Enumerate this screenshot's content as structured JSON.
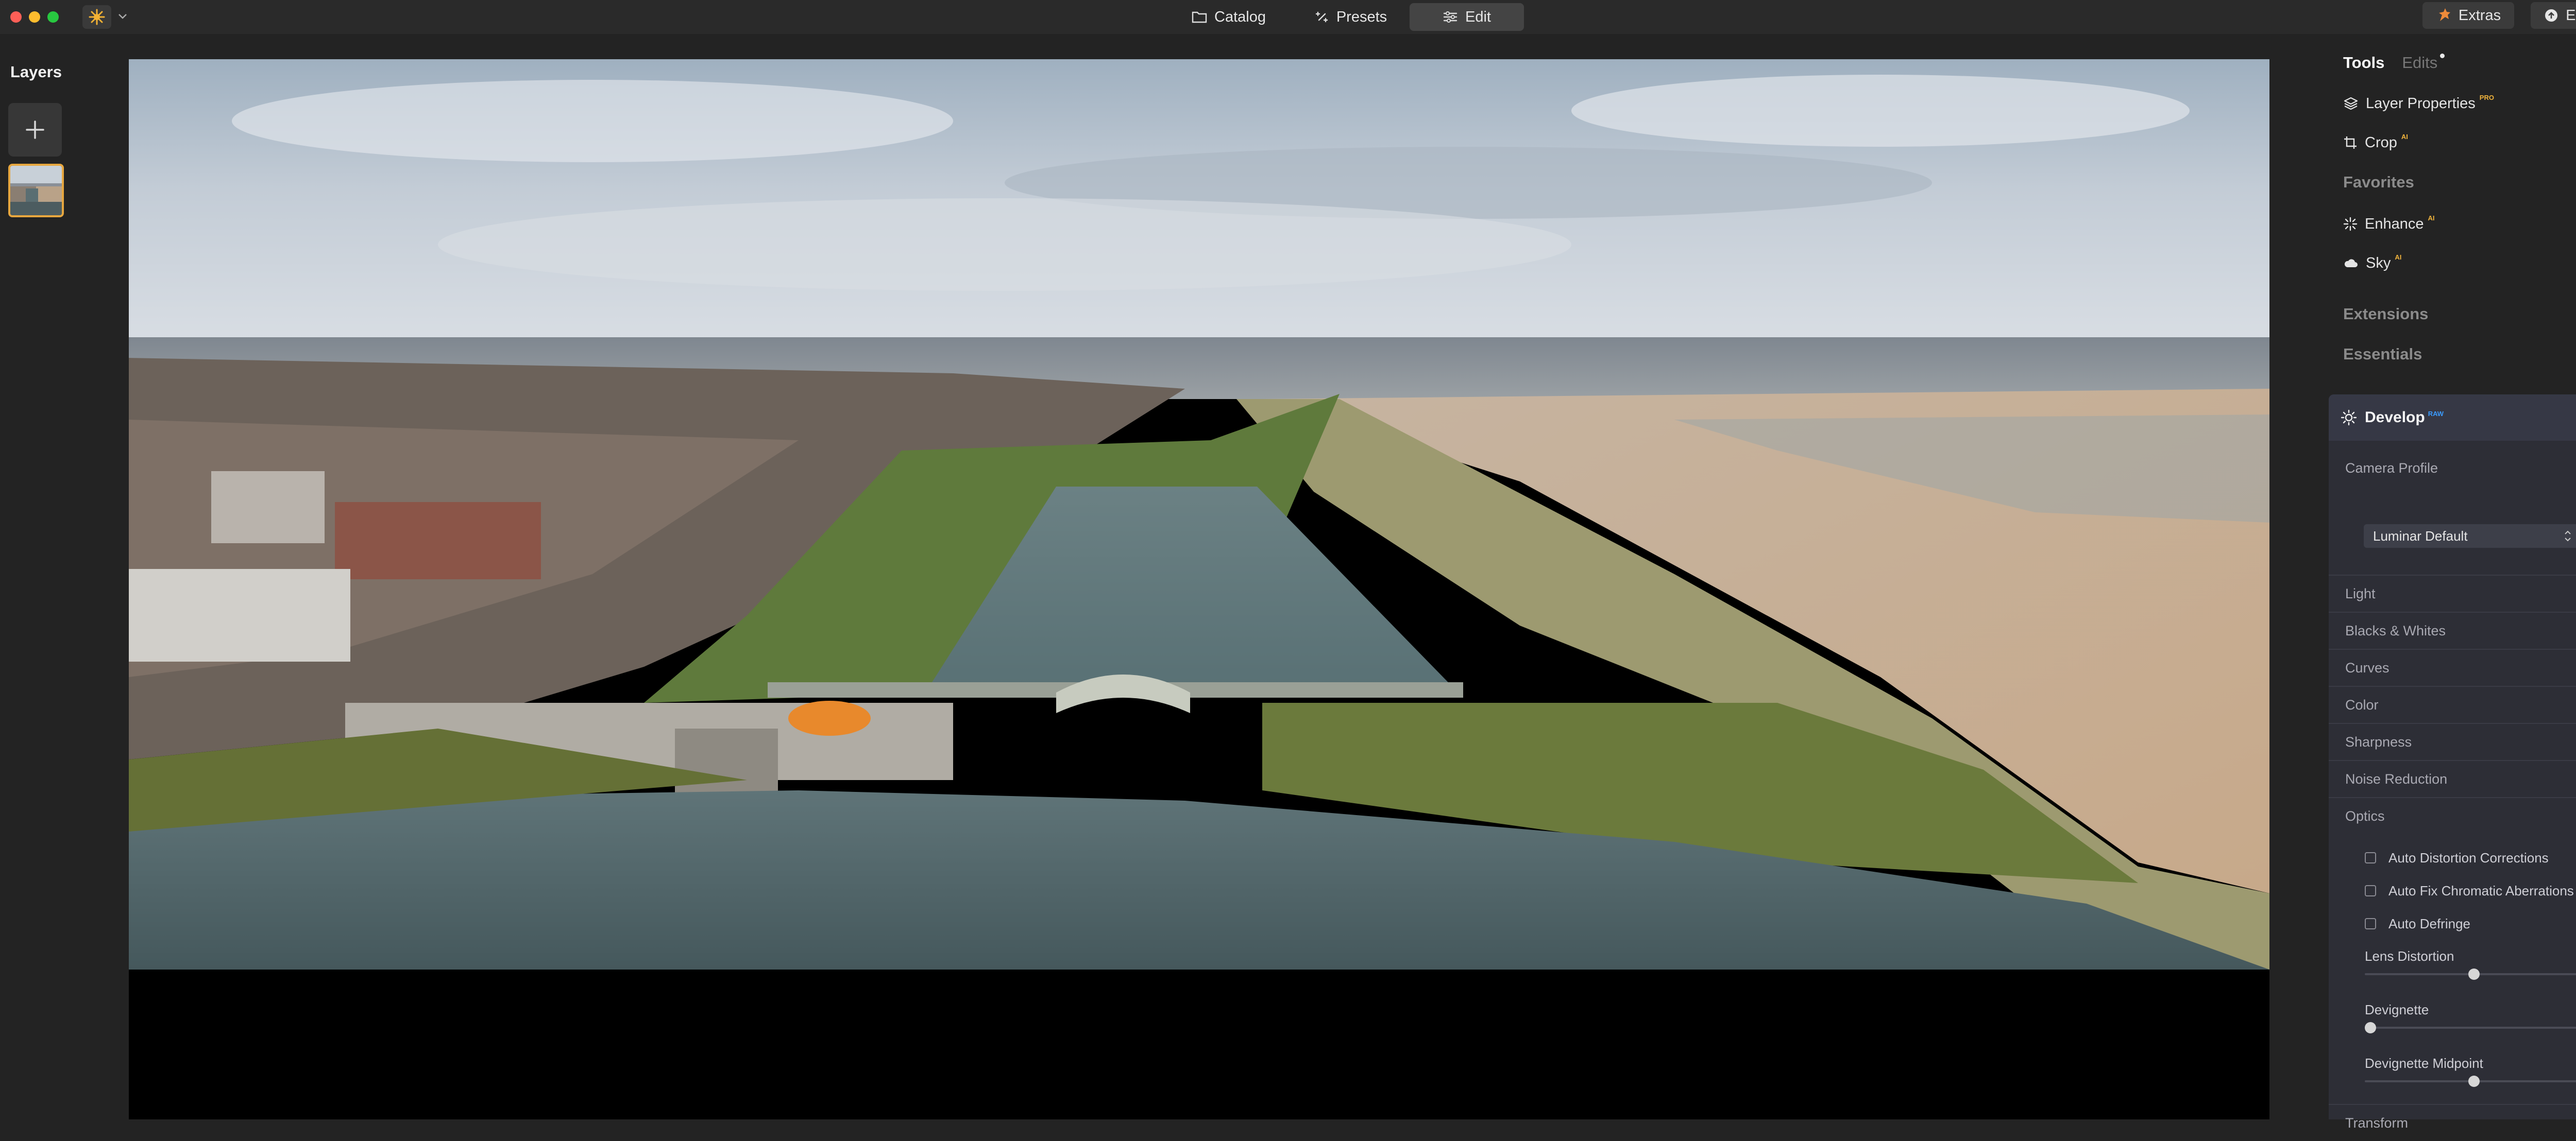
{
  "toolbar": {
    "nav": [
      {
        "label": "Catalog",
        "icon": "folder-icon"
      },
      {
        "label": "Presets",
        "icon": "presets-icon"
      },
      {
        "label": "Edit",
        "icon": "sliders-icon",
        "active": true
      }
    ],
    "extras_label": "Extras",
    "export_label": "Export",
    "accent_color": "#e7a73f"
  },
  "layers": {
    "title": "Layers"
  },
  "right_panel": {
    "tabs": {
      "tools": "Tools",
      "edits": "Edits"
    },
    "tools": [
      {
        "label": "Layer Properties",
        "badge": "PRO",
        "icon": "layers-icon"
      },
      {
        "label": "Crop",
        "badge": "AI",
        "icon": "crop-icon"
      }
    ],
    "favorites_title": "Favorites",
    "favorites": [
      {
        "label": "Enhance",
        "badge": "AI",
        "icon": "sparkle-icon"
      },
      {
        "label": "Sky",
        "badge": "AI",
        "icon": "cloud-icon"
      }
    ],
    "extensions_title": "Extensions",
    "essentials_title": "Essentials",
    "develop": {
      "title": "Develop",
      "badge": "RAW",
      "camera_profile_label": "Camera Profile",
      "camera_profile_value": "Luminar Default",
      "sections": [
        "Light",
        "Blacks & Whites",
        "Curves",
        "Color",
        "Sharpness",
        "Noise Reduction"
      ],
      "optics": {
        "label": "Optics",
        "checkboxes": [
          {
            "label": "Auto Distortion Corrections",
            "checked": false
          },
          {
            "label": "Auto Fix Chromatic Aberrations",
            "checked": false
          },
          {
            "label": "Auto Defringe",
            "checked": false
          }
        ],
        "sliders": [
          {
            "label": "Lens Distortion",
            "value": "0",
            "position": 0.5
          },
          {
            "label": "Devignette",
            "value": "0",
            "position": 0.0
          },
          {
            "label": "Devignette Midpoint",
            "value": "0",
            "position": 0.5
          }
        ]
      },
      "transform_label": "Transform"
    }
  }
}
